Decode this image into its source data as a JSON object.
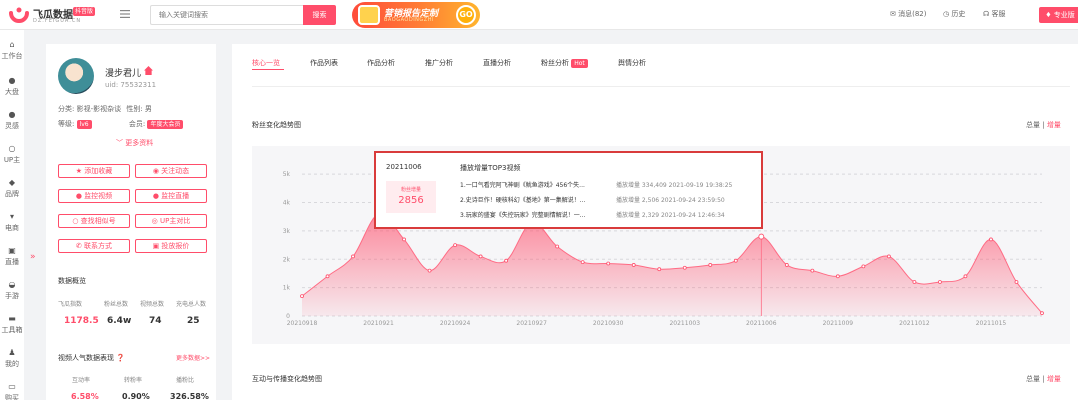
{
  "topbar": {
    "brand": "飞瓜数据",
    "brand_badge": "抖音版",
    "brand_domain": "DZ.FEIGUA.CN",
    "search_placeholder": "输入关键词搜索",
    "search_button": "搜索",
    "banner_title": "营销报告定制",
    "banner_sub": "BAOGAODINGZHI",
    "banner_go": "GO",
    "messages": "消息(82)",
    "history": "历史",
    "service": "客服",
    "pro": "专业版",
    "accent_color": "#ff4d6a"
  },
  "sidebar": {
    "items": [
      {
        "label": "工作台",
        "icon": "home-icon"
      },
      {
        "label": "大盘",
        "icon": "chart-icon"
      },
      {
        "label": "灵感",
        "icon": "bulb-icon"
      },
      {
        "label": "UP主",
        "icon": "search-icon"
      },
      {
        "label": "品牌",
        "icon": "diamond-icon"
      },
      {
        "label": "电商",
        "icon": "cart-icon"
      },
      {
        "label": "直播",
        "icon": "tv-icon"
      },
      {
        "label": "手游",
        "icon": "gamepad-icon"
      },
      {
        "label": "工具箱",
        "icon": "toolbox-icon"
      },
      {
        "label": "我的",
        "icon": "user-icon"
      },
      {
        "label": "购买",
        "icon": "card-icon"
      }
    ],
    "collapse_glyph": "»"
  },
  "profile": {
    "name": "漫步君儿",
    "uid": "uid: 75532311",
    "category": "分类: 影视-影视杂谈",
    "gender": "性别: 男",
    "level_label": "等级:",
    "level": "lv6",
    "member_label": "会员:",
    "member": "年度大会员",
    "more": "更多资料",
    "buttons": [
      "添加收藏",
      "关注动态",
      "监控视频",
      "监控直播",
      "查找相似号",
      "UP主对比",
      "联系方式",
      "投放报价"
    ],
    "overview_title": "数据概览",
    "overview": [
      {
        "label": "飞瓜指数",
        "value": "1178.5"
      },
      {
        "label": "粉丝总数",
        "value": "6.4w"
      },
      {
        "label": "视频总数",
        "value": "74"
      },
      {
        "label": "充电总人数",
        "value": "25"
      }
    ],
    "perf_title": "视频人气数据表现",
    "perf_more": "更多数据>>",
    "perf": [
      {
        "label": "互动率",
        "value": "6.58%"
      },
      {
        "label": "转粉率",
        "value": "0.90%"
      },
      {
        "label": "播粉比",
        "value": "326.58%"
      }
    ]
  },
  "main": {
    "tabs": [
      "核心一览",
      "作品列表",
      "作品分析",
      "推广分析",
      "直播分析",
      "粉丝分析",
      "舆情分析"
    ],
    "hot_badge": "Hot",
    "section1_title": "粉丝变化趋势图",
    "section2_title": "互动与传播变化趋势图",
    "toggle_total": "总量",
    "toggle_delta": "增量",
    "separator": "|"
  },
  "tooltip": {
    "date": "20211006",
    "heading": "播放增量TOP3视频",
    "box_label": "粉丝增量",
    "box_value": "2856",
    "videos": [
      {
        "title": "1.一口气看完阿飞神剧《鱿鱼游戏》456个失...",
        "meta": "播放增量 334,409  2021-09-19 19:38:25"
      },
      {
        "title": "2.史诗巨作！硬核科幻《基地》第一集解说！...",
        "meta": "播放增量 2,506  2021-09-24 23:59:50"
      },
      {
        "title": "3.玩家的盛宴《失控玩家》完整剧情解说！一...",
        "meta": "播放增量 2,329  2021-09-24 12:46:34"
      }
    ]
  },
  "chart_data": {
    "type": "area",
    "color": "#ff4d6a",
    "xlabels": [
      "20210918",
      "20210921",
      "20210924",
      "20210927",
      "20210930",
      "20211003",
      "20211006",
      "20211009",
      "20211012",
      "20211015"
    ],
    "ylabels": [
      "0",
      "1k",
      "2k",
      "3k",
      "4k",
      "5k"
    ],
    "ylim": [
      0,
      5500
    ],
    "x_count": 30,
    "values": [
      700,
      1400,
      2100,
      3600,
      2700,
      1600,
      2500,
      2100,
      1950,
      3300,
      2450,
      1900,
      1850,
      1800,
      1650,
      1700,
      1800,
      1950,
      2800,
      1800,
      1600,
      1400,
      1750,
      2100,
      1200,
      1200,
      1400,
      2700,
      1200,
      100
    ],
    "highlight_index": 18
  }
}
